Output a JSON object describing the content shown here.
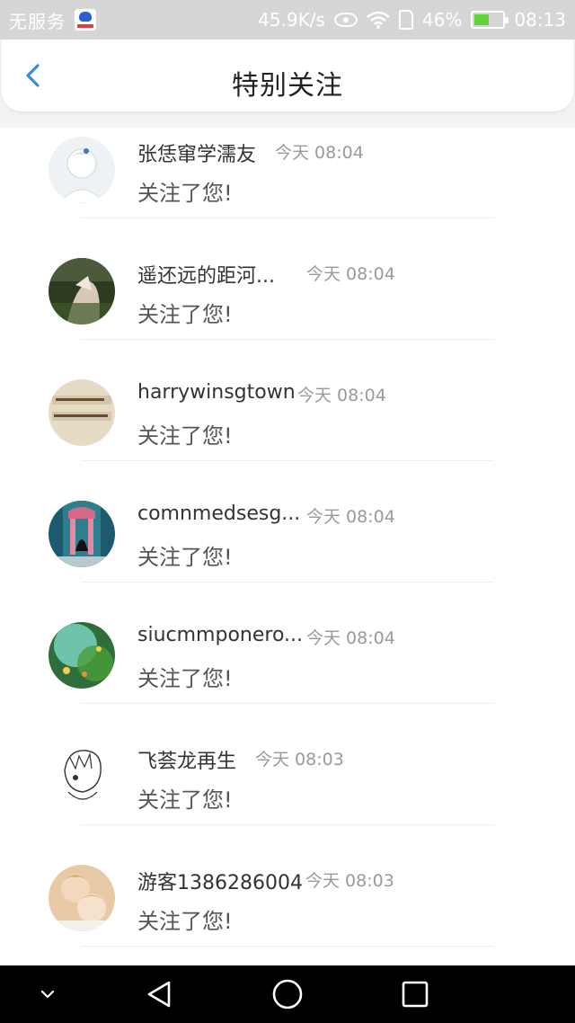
{
  "status_bar": {
    "carrier": "无服务",
    "speed": "45.9K/s",
    "battery": "46%",
    "battery_level": 0.46,
    "time": "08:13",
    "icons": [
      "baidu-icon",
      "eye-icon",
      "wifi-icon",
      "sim-icon",
      "battery-icon"
    ]
  },
  "header": {
    "title": "特别关注",
    "back_icon": "chevron-left-icon"
  },
  "list": {
    "items": [
      {
        "name": "张恁窜学濡友",
        "time": "今天 08:04",
        "message": "关注了您!"
      },
      {
        "name": "遥还远的距河...",
        "time": "今天 08:04",
        "message": "关注了您!"
      },
      {
        "name": "harrywinsgtown",
        "time": "今天 08:04",
        "message": "关注了您!"
      },
      {
        "name": "comnmedsesg...",
        "time": "今天 08:04",
        "message": "关注了您!"
      },
      {
        "name": "siucmmponero...",
        "time": "今天 08:04",
        "message": "关注了您!"
      },
      {
        "name": "飞荟龙再生",
        "time": "今天 08:03",
        "message": "关注了您!"
      },
      {
        "name": "游客1386286004",
        "time": "今天 08:03",
        "message": "关注了您!"
      }
    ]
  },
  "nav_bar": {
    "icons": [
      "hide-icon",
      "back-triangle-icon",
      "home-circle-icon",
      "recent-square-icon"
    ]
  },
  "colors": {
    "accent": "#3b8ae6",
    "status_bar_bg": "#d6d6d6",
    "header_bg": "#ffffff",
    "title_text": "#222222",
    "name_text": "#333333",
    "time_text": "#9a9a9a",
    "message_text": "#555555",
    "divider": "#eeeeee",
    "nav_bar_bg": "#000000"
  }
}
